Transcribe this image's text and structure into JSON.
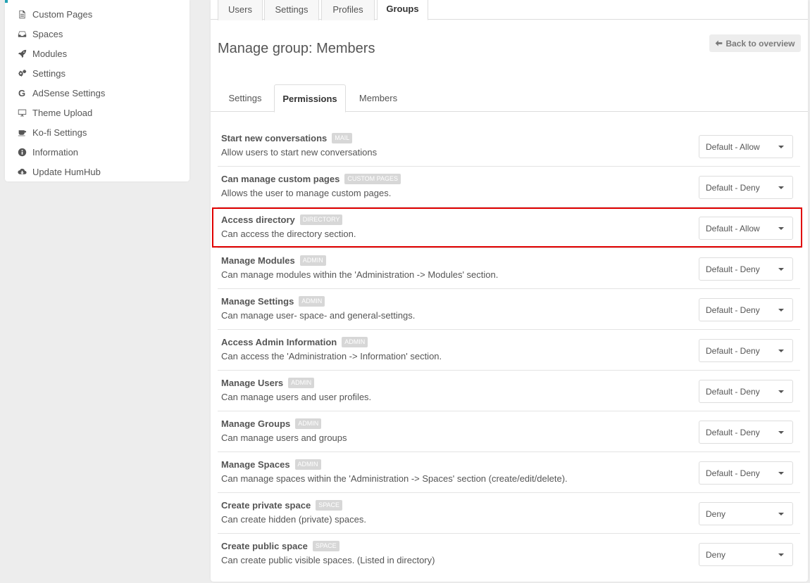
{
  "sidebar": {
    "items": [
      {
        "label": "Custom Pages",
        "icon": "file-icon"
      },
      {
        "label": "Spaces",
        "icon": "inbox-icon"
      },
      {
        "label": "Modules",
        "icon": "rocket-icon"
      },
      {
        "label": "Settings",
        "icon": "gears-icon"
      },
      {
        "label": "AdSense Settings",
        "icon": "google-icon"
      },
      {
        "label": "Theme Upload",
        "icon": "desktop-icon"
      },
      {
        "label": "Ko-fi Settings",
        "icon": "coffee-icon"
      },
      {
        "label": "Information",
        "icon": "info-icon"
      },
      {
        "label": "Update HumHub",
        "icon": "cloud-download-icon"
      }
    ]
  },
  "top_tabs": [
    "Users",
    "Settings",
    "Profiles",
    "Groups"
  ],
  "active_top_tab": "Groups",
  "page": {
    "title": "Manage group: Members",
    "back_label": "Back to overview"
  },
  "sub_tabs": [
    "Settings",
    "Permissions",
    "Members"
  ],
  "active_sub_tab": "Permissions",
  "permissions": [
    {
      "title": "Start new conversations",
      "badge": "MAIL",
      "desc": "Allow users to start new conversations",
      "value": "Default - Allow"
    },
    {
      "title": "Can manage custom pages",
      "badge": "CUSTOM PAGES",
      "desc": "Allows the user to manage custom pages.",
      "value": "Default - Deny"
    },
    {
      "title": "Access directory",
      "badge": "DIRECTORY",
      "desc": "Can access the directory section.",
      "value": "Default - Allow"
    },
    {
      "title": "Manage Modules",
      "badge": "ADMIN",
      "desc": "Can manage modules within the 'Administration -> Modules' section.",
      "value": "Default - Deny"
    },
    {
      "title": "Manage Settings",
      "badge": "ADMIN",
      "desc": "Can manage user- space- and general-settings.",
      "value": "Default - Deny"
    },
    {
      "title": "Access Admin Information",
      "badge": "ADMIN",
      "desc": "Can access the 'Administration -> Information' section.",
      "value": "Default - Deny"
    },
    {
      "title": "Manage Users",
      "badge": "ADMIN",
      "desc": "Can manage users and user profiles.",
      "value": "Default - Deny"
    },
    {
      "title": "Manage Groups",
      "badge": "ADMIN",
      "desc": "Can manage users and groups",
      "value": "Default - Deny"
    },
    {
      "title": "Manage Spaces",
      "badge": "ADMIN",
      "desc": "Can manage spaces within the 'Administration -> Spaces' section (create/edit/delete).",
      "value": "Default - Deny"
    },
    {
      "title": "Create private space",
      "badge": "SPACE",
      "desc": "Can create hidden (private) spaces.",
      "value": "Deny"
    },
    {
      "title": "Create public space",
      "badge": "SPACE",
      "desc": "Can create public visible spaces. (Listed in directory)",
      "value": "Deny"
    }
  ],
  "highlighted_row": "Access directory",
  "colors": {
    "accent": "#21a1b3",
    "highlight_border": "#e00000",
    "badge_bg": "#d7d7d7"
  }
}
